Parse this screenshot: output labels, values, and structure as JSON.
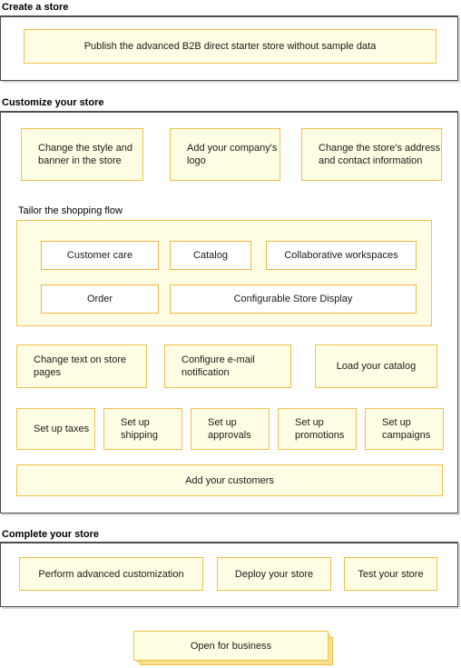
{
  "sections": [
    {
      "id": "create-a-store",
      "title": "Create a store",
      "cards": [
        {
          "id": "publish-starter-store",
          "label": "Publish the advanced B2B direct starter store without sample data",
          "align": "center"
        }
      ]
    },
    {
      "id": "customize-your-store",
      "title": "Customize your store",
      "row1": [
        {
          "id": "change-style-banner",
          "label": "Change the style and banner in the store",
          "align": "left"
        },
        {
          "id": "add-company-logo",
          "label": "Add your company's logo",
          "align": "left"
        },
        {
          "id": "change-store-address",
          "label": "Change the store's address and contact information",
          "align": "left"
        }
      ],
      "subsection": {
        "id": "tailor-the-shopping-flow",
        "title": "Tailor the shopping flow",
        "row1": [
          {
            "id": "customer-care",
            "label": "Customer care"
          },
          {
            "id": "catalog",
            "label": "Catalog"
          },
          {
            "id": "collaborative-workspaces",
            "label": "Collaborative workspaces"
          }
        ],
        "row2": [
          {
            "id": "order",
            "label": "Order"
          },
          {
            "id": "configurable-store-display",
            "label": "Configurable Store Display"
          }
        ]
      },
      "row2": [
        {
          "id": "change-text-store-pages",
          "label": "Change text on store pages",
          "align": "left"
        },
        {
          "id": "configure-email-notification",
          "label": "Configure e-mail notification",
          "align": "left"
        },
        {
          "id": "load-your-catalog",
          "label": "Load your catalog",
          "align": "center"
        }
      ],
      "row3": [
        {
          "id": "set-up-taxes",
          "label": "Set up taxes",
          "align": "left"
        },
        {
          "id": "set-up-shipping",
          "label": "Set up shipping",
          "align": "left"
        },
        {
          "id": "set-up-approvals",
          "label": "Set up approvals",
          "align": "left"
        },
        {
          "id": "set-up-promotions",
          "label": "Set up promotions",
          "align": "left"
        },
        {
          "id": "set-up-campaigns",
          "label": "Set up campaigns",
          "align": "left"
        }
      ],
      "row4": [
        {
          "id": "add-your-customers",
          "label": "Add your customers",
          "align": "center"
        }
      ]
    },
    {
      "id": "complete-your-store",
      "title": "Complete your store",
      "cards": [
        {
          "id": "perform-advanced-customization",
          "label": "Perform advanced customization",
          "align": "center"
        },
        {
          "id": "deploy-your-store",
          "label": "Deploy your store",
          "align": "center"
        },
        {
          "id": "test-your-store",
          "label": "Test your store",
          "align": "center"
        }
      ]
    }
  ],
  "final": {
    "id": "open-for-business",
    "label": "Open for business",
    "align": "center"
  },
  "colors": {
    "card_fill": "#FFFDE3",
    "card_border": "#F2C14A",
    "shadow_mid": "#FDE9A8",
    "shadow_back": "#FBDF8C",
    "panel_border": "#4D4D4D",
    "panel_shadow": "#D9D9D9",
    "flat_card_border": "#F2B544",
    "text": "#1A1A1A"
  }
}
